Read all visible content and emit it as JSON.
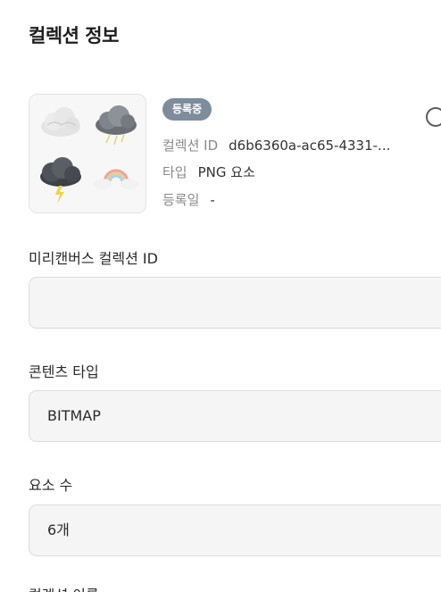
{
  "page_title": "컬렉션 정보",
  "thumbnail": {
    "icons": [
      "cloud-icon",
      "storm-cloud-icon",
      "thunder-cloud-icon",
      "rainbow-cloud-icon"
    ]
  },
  "status_badge": "등록중",
  "meta": {
    "collection_id_label": "컬렉션 ID",
    "collection_id_value": "d6b6360a-ac65-4331-...",
    "type_label": "타입",
    "type_value": "PNG 요소",
    "registered_label": "등록일",
    "registered_value": "-"
  },
  "fields": {
    "miricanvas_id": {
      "label": "미리캔버스 컬렉션 ID",
      "value": ""
    },
    "content_type": {
      "label": "콘텐츠 타입",
      "value": "BITMAP"
    },
    "element_count": {
      "label": "요소 수",
      "value": "6개"
    },
    "collection_name": {
      "label": "컬렉션 이름"
    }
  },
  "colors": {
    "badge": "#7e8c9c",
    "field_bg": "#f5f5f5",
    "field_border": "#dcdcdc"
  }
}
